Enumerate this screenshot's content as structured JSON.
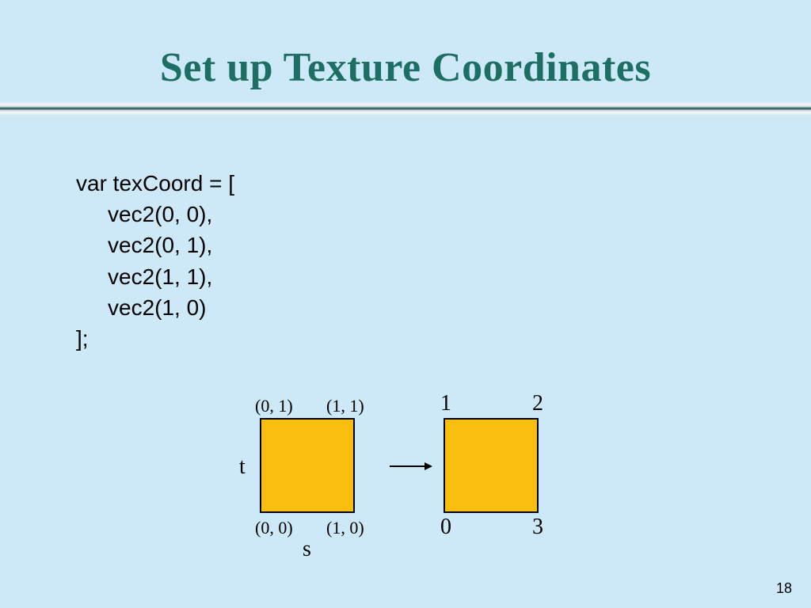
{
  "title": "Set up Texture Coordinates",
  "code": {
    "l1": "var texCoord = [",
    "l2": "vec2(0, 0),",
    "l3": "vec2(0, 1),",
    "l4": "vec2(1, 1),",
    "l5": "vec2(1, 0)",
    "l6": "];"
  },
  "diagram": {
    "left_tl": "(0, 1)",
    "left_tr": "(1, 1)",
    "left_bl": "(0, 0)",
    "left_br": "(1, 0)",
    "axis_t": "t",
    "axis_s": "s",
    "right_tl": "1",
    "right_tr": "2",
    "right_bl": "0",
    "right_br": "3"
  },
  "page_number": "18"
}
